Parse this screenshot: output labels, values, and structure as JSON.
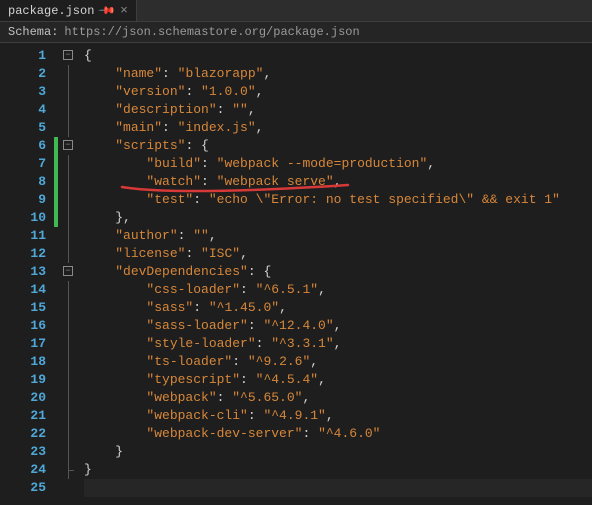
{
  "tab": {
    "filename": "package.json"
  },
  "schema": {
    "label": "Schema:",
    "url": "https://json.schemastore.org/package.json"
  },
  "lines": {
    "l1": "1",
    "l2": "2",
    "l3": "3",
    "l4": "4",
    "l5": "5",
    "l6": "6",
    "l7": "7",
    "l8": "8",
    "l9": "9",
    "l10": "10",
    "l11": "11",
    "l12": "12",
    "l13": "13",
    "l14": "14",
    "l15": "15",
    "l16": "16",
    "l17": "17",
    "l18": "18",
    "l19": "19",
    "l20": "20",
    "l21": "21",
    "l22": "22",
    "l23": "23",
    "l24": "24",
    "l25": "25"
  },
  "json": {
    "name_k": "\"name\"",
    "name_v": "\"blazorapp\"",
    "version_k": "\"version\"",
    "version_v": "\"1.0.0\"",
    "description_k": "\"description\"",
    "description_v": "\"\"",
    "main_k": "\"main\"",
    "main_v": "\"index.js\"",
    "scripts_k": "\"scripts\"",
    "build_k": "\"build\"",
    "build_v": "\"webpack --mode=production\"",
    "watch_k": "\"watch\"",
    "watch_v": "\"webpack serve\"",
    "test_k": "\"test\"",
    "test_v": "\"echo \\\"Error: no test specified\\\" && exit 1\"",
    "author_k": "\"author\"",
    "author_v": "\"\"",
    "license_k": "\"license\"",
    "license_v": "\"ISC\"",
    "devdeps_k": "\"devDependencies\"",
    "cssloader_k": "\"css-loader\"",
    "cssloader_v": "\"^6.5.1\"",
    "sass_k": "\"sass\"",
    "sass_v": "\"^1.45.0\"",
    "sassloader_k": "\"sass-loader\"",
    "sassloader_v": "\"^12.4.0\"",
    "styleloader_k": "\"style-loader\"",
    "styleloader_v": "\"^3.3.1\"",
    "tsloader_k": "\"ts-loader\"",
    "tsloader_v": "\"^9.2.6\"",
    "typescript_k": "\"typescript\"",
    "typescript_v": "\"^4.5.4\"",
    "webpack_k": "\"webpack\"",
    "webpack_v": "\"^5.65.0\"",
    "webpackcli_k": "\"webpack-cli\"",
    "webpackcli_v": "\"^4.9.1\"",
    "webpackdev_k": "\"webpack-dev-server\"",
    "webpackdev_v": "\"^4.6.0\""
  }
}
